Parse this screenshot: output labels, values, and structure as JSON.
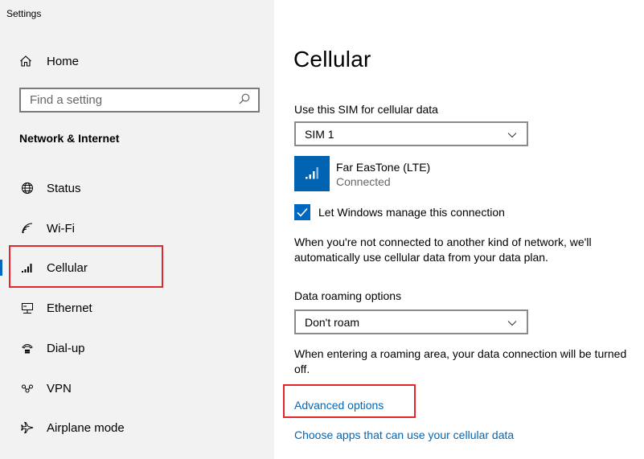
{
  "window": {
    "title": "Settings"
  },
  "sidebar": {
    "home_label": "Home",
    "search_placeholder": "Find a setting",
    "section_title": "Network & Internet",
    "items": [
      {
        "label": "Status",
        "icon": "globe-icon"
      },
      {
        "label": "Wi-Fi",
        "icon": "wifi-icon"
      },
      {
        "label": "Cellular",
        "icon": "cellular-icon",
        "active": true
      },
      {
        "label": "Ethernet",
        "icon": "ethernet-icon"
      },
      {
        "label": "Dial-up",
        "icon": "dialup-icon"
      },
      {
        "label": "VPN",
        "icon": "vpn-icon"
      },
      {
        "label": "Airplane mode",
        "icon": "airplane-icon"
      }
    ]
  },
  "main": {
    "title": "Cellular",
    "sim_label": "Use this SIM for cellular data",
    "sim_value": "SIM 1",
    "carrier_name": "Far EasTone (LTE)",
    "carrier_status": "Connected",
    "manage_label": "Let Windows manage this connection",
    "manage_checked": true,
    "manage_desc": "When you're not connected to another kind of network, we'll automatically use cellular data from your data plan.",
    "roaming_label": "Data roaming options",
    "roaming_value": "Don't roam",
    "roaming_desc": "When entering a roaming area, your data connection will be turned off.",
    "advanced_link": "Advanced options",
    "apps_link": "Choose apps that can use your cellular data"
  },
  "colors": {
    "accent": "#0067c0",
    "link": "#0067b8",
    "tile": "#0063b1",
    "highlight": "#e3262c",
    "sidebar_bg": "#f2f2f2"
  }
}
